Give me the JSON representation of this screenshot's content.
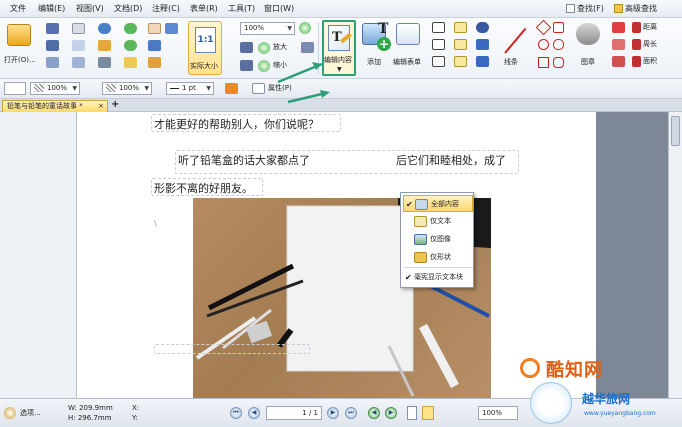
{
  "menubar": {
    "items": [
      "文件",
      "编辑(E)",
      "视图(V)",
      "文档(D)",
      "注释(C)",
      "表单(R)",
      "工具(T)",
      "窗口(W)"
    ],
    "find_label": "查找(F)",
    "advanced_search_label": "高级查找"
  },
  "ribbon": {
    "open_label": "打开(O)...",
    "zoom_value": "100%",
    "actual_size_label": "实际大小",
    "zoom_in_label": "放大",
    "zoom_out_label": "缩小",
    "edit_content_label": "编辑内容",
    "add_label": "添加",
    "edit_form_label": "编辑表单",
    "lines_label": "线条",
    "stamp_label": "图章",
    "distance_label": "距离",
    "perimeter_label": "周长",
    "area_label": "面积"
  },
  "format_toolbar": {
    "fill_opacity": "100%",
    "stroke_opacity": "100%",
    "line_width": "1 pt",
    "properties_label": "属性(P)"
  },
  "tab": {
    "title": "铅笔与铅笔的童话故事 *",
    "new_tab": "+"
  },
  "document": {
    "line1": "才能更好的帮助别人，你们说呢？",
    "line2_a": "听了铅笔盒的话大家都点了",
    "line2_b": "后它们和睦相处，成了",
    "line3": "形影不离的好朋友。"
  },
  "dropdown": {
    "items": [
      {
        "label": "全部内容",
        "checked": true
      },
      {
        "label": "仅文本",
        "checked": false
      },
      {
        "label": "仅图像",
        "checked": false
      },
      {
        "label": "仅形状",
        "checked": false
      },
      {
        "label": "毫宪显示文本块",
        "checked": true
      }
    ]
  },
  "statusbar": {
    "settings_label": "选项...",
    "width": "W: 209.9mm",
    "height": "H: 296.7mm",
    "x_label": "X:",
    "y_label": "Y:",
    "page_indicator": "1 / 1",
    "zoom_value": "100%"
  },
  "watermark": {
    "brand": "酷知网",
    "brand2": "越华旅网",
    "url": "www.yueyangbang.com"
  },
  "colors": {
    "menu_bg": "#e6ebf2",
    "tab_active": "#ffd966",
    "highlight_green": "#2e9e7a",
    "watermark_orange": "#f08020"
  }
}
